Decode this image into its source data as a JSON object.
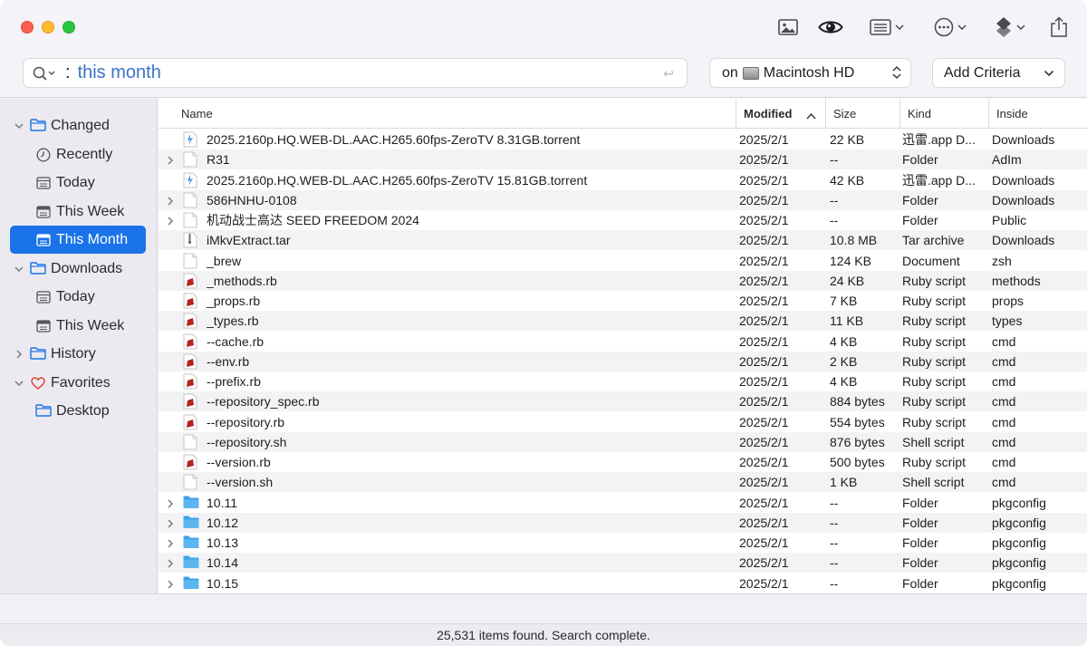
{
  "search": {
    "colon": ":",
    "query": "this month",
    "return_glyph": "↩",
    "scope_prefix": "on",
    "scope_volume": "Macintosh HD",
    "criteria_label": "Add Criteria"
  },
  "toolbar": {
    "icons": [
      "image-icon",
      "eye-icon",
      "list-view-icon",
      "more-icon",
      "tag-icon",
      "share-icon"
    ]
  },
  "sidebar": {
    "groups": [
      {
        "label": "Changed",
        "items": [
          "Recently",
          "Today",
          "This Week",
          "This Month"
        ]
      },
      {
        "label": "Downloads",
        "items": [
          "Today",
          "This Week"
        ]
      },
      {
        "label": "History",
        "items": []
      },
      {
        "label": "Favorites",
        "items": [
          "Desktop"
        ]
      }
    ],
    "selected": "This Month"
  },
  "table": {
    "columns": [
      "Name",
      "Modified",
      "Size",
      "Kind",
      "Inside"
    ],
    "sorted_column": "Modified",
    "rows": [
      {
        "name": "2025.2160p.HQ.WEB-DL.AAC.H265.60fps-ZeroTV 8.31GB.torrent",
        "modified": "2025/2/1",
        "size": "22 KB",
        "kind": "迅雷.app D...",
        "inside": "Downloads",
        "icon": "torrent",
        "expandable": false
      },
      {
        "name": "R31",
        "modified": "2025/2/1",
        "size": "--",
        "kind": "Folder",
        "inside": "AdIm",
        "icon": "blank",
        "expandable": true
      },
      {
        "name": "2025.2160p.HQ.WEB-DL.AAC.H265.60fps-ZeroTV 15.81GB.torrent",
        "modified": "2025/2/1",
        "size": "42 KB",
        "kind": "迅雷.app D...",
        "inside": "Downloads",
        "icon": "torrent",
        "expandable": false
      },
      {
        "name": "586HNHU-0108",
        "modified": "2025/2/1",
        "size": "--",
        "kind": "Folder",
        "inside": "Downloads",
        "icon": "blank",
        "expandable": true
      },
      {
        "name": "机动战士高达 SEED FREEDOM 2024",
        "modified": "2025/2/1",
        "size": "--",
        "kind": "Folder",
        "inside": "Public",
        "icon": "blank",
        "expandable": true
      },
      {
        "name": "iMkvExtract.tar",
        "modified": "2025/2/1",
        "size": "10.8 MB",
        "kind": "Tar archive",
        "inside": "Downloads",
        "icon": "archive",
        "expandable": false
      },
      {
        "name": "_brew",
        "modified": "2025/2/1",
        "size": "124 KB",
        "kind": "Document",
        "inside": "zsh",
        "icon": "blank",
        "expandable": false
      },
      {
        "name": "_methods.rb",
        "modified": "2025/2/1",
        "size": "24 KB",
        "kind": "Ruby script",
        "inside": "methods",
        "icon": "ruby",
        "expandable": false
      },
      {
        "name": "_props.rb",
        "modified": "2025/2/1",
        "size": "7 KB",
        "kind": "Ruby script",
        "inside": "props",
        "icon": "ruby",
        "expandable": false
      },
      {
        "name": "_types.rb",
        "modified": "2025/2/1",
        "size": "11 KB",
        "kind": "Ruby script",
        "inside": "types",
        "icon": "ruby",
        "expandable": false
      },
      {
        "name": "--cache.rb",
        "modified": "2025/2/1",
        "size": "4 KB",
        "kind": "Ruby script",
        "inside": "cmd",
        "icon": "ruby",
        "expandable": false
      },
      {
        "name": "--env.rb",
        "modified": "2025/2/1",
        "size": "2 KB",
        "kind": "Ruby script",
        "inside": "cmd",
        "icon": "ruby",
        "expandable": false
      },
      {
        "name": "--prefix.rb",
        "modified": "2025/2/1",
        "size": "4 KB",
        "kind": "Ruby script",
        "inside": "cmd",
        "icon": "ruby",
        "expandable": false
      },
      {
        "name": "--repository_spec.rb",
        "modified": "2025/2/1",
        "size": "884 bytes",
        "kind": "Ruby script",
        "inside": "cmd",
        "icon": "ruby",
        "expandable": false
      },
      {
        "name": "--repository.rb",
        "modified": "2025/2/1",
        "size": "554 bytes",
        "kind": "Ruby script",
        "inside": "cmd",
        "icon": "ruby",
        "expandable": false
      },
      {
        "name": "--repository.sh",
        "modified": "2025/2/1",
        "size": "876 bytes",
        "kind": "Shell script",
        "inside": "cmd",
        "icon": "blank",
        "expandable": false
      },
      {
        "name": "--version.rb",
        "modified": "2025/2/1",
        "size": "500 bytes",
        "kind": "Ruby script",
        "inside": "cmd",
        "icon": "ruby",
        "expandable": false
      },
      {
        "name": "--version.sh",
        "modified": "2025/2/1",
        "size": "1 KB",
        "kind": "Shell script",
        "inside": "cmd",
        "icon": "blank",
        "expandable": false
      },
      {
        "name": "10.11",
        "modified": "2025/2/1",
        "size": "--",
        "kind": "Folder",
        "inside": "pkgconfig",
        "icon": "folder",
        "expandable": true
      },
      {
        "name": "10.12",
        "modified": "2025/2/1",
        "size": "--",
        "kind": "Folder",
        "inside": "pkgconfig",
        "icon": "folder",
        "expandable": true
      },
      {
        "name": "10.13",
        "modified": "2025/2/1",
        "size": "--",
        "kind": "Folder",
        "inside": "pkgconfig",
        "icon": "folder",
        "expandable": true
      },
      {
        "name": "10.14",
        "modified": "2025/2/1",
        "size": "--",
        "kind": "Folder",
        "inside": "pkgconfig",
        "icon": "folder",
        "expandable": true
      },
      {
        "name": "10.15",
        "modified": "2025/2/1",
        "size": "--",
        "kind": "Folder",
        "inside": "pkgconfig",
        "icon": "folder",
        "expandable": true
      }
    ]
  },
  "status": "25,531 items found. Search complete.",
  "colors": {
    "accent": "#1a73e8",
    "query_text": "#3a73c8",
    "folder_blue": "#3ea3e8",
    "ruby_red": "#b4231f",
    "favorites_heart": "#e0433a"
  }
}
